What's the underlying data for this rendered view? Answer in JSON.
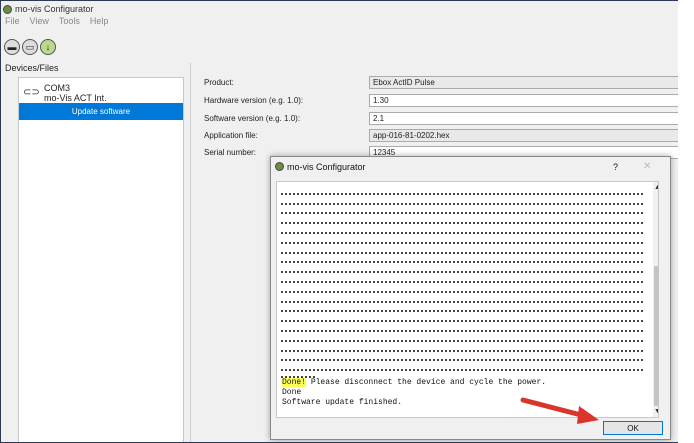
{
  "app": {
    "title": "mo-vis Configurator"
  },
  "menu": [
    "File",
    "View",
    "Tools",
    "Help"
  ],
  "toolbar": {
    "icons": [
      "open-icon",
      "save-icon",
      "download-icon"
    ]
  },
  "devices_pane": {
    "title": "Devices/Files",
    "device": {
      "port": "COM3",
      "name": "mo-Vis ACT Int."
    },
    "selected_item": "Update software"
  },
  "form": {
    "fields": [
      {
        "label": "Product:",
        "value": "Ebox ActID Pulse"
      },
      {
        "label": "Hardware version (e.g. 1.0):",
        "value": "1.30"
      },
      {
        "label": "Software version (e.g. 1.0):",
        "value": "2.1"
      },
      {
        "label": "Application file:",
        "value": "app-016-81-0202.hex"
      },
      {
        "label": "Serial number:",
        "value": "12345"
      }
    ]
  },
  "dialog": {
    "title": "mo-vis Configurator",
    "help": "?",
    "close": "✕",
    "log": {
      "done_word": "Done!",
      "line1_rest": " Please disconnect the device and cycle the power.",
      "line2": "Done",
      "line3": "Software update finished."
    },
    "ok_label": "OK"
  },
  "colors": {
    "selection": "#0078d7",
    "highlight": "#ffff55",
    "arrow": "#d9352b"
  }
}
